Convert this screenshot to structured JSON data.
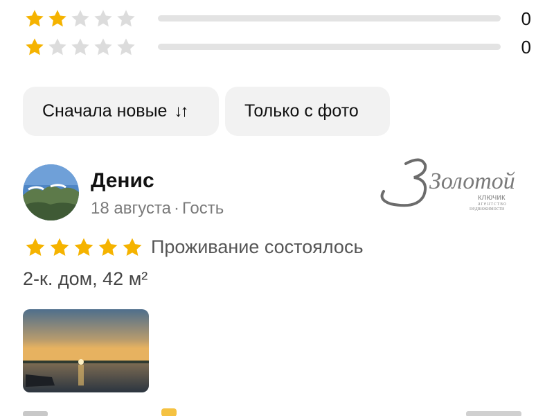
{
  "ratings": [
    {
      "stars": 2,
      "fraction": 0,
      "count": "0"
    },
    {
      "stars": 1,
      "fraction": 0,
      "count": "0"
    }
  ],
  "filters": {
    "sort_label": "Сначала новые",
    "sort_icon": "sort-arrows-icon",
    "photo_label": "Только с фото"
  },
  "review": {
    "author": "Денис",
    "date": "18 августа",
    "separator": "·",
    "role": "Гость",
    "stars": 5,
    "stay_status": "Проживание состоялось",
    "property": "2-к. дом, 42 м²"
  },
  "watermark": {
    "brand": "Золотой",
    "line1": "ключик",
    "line2": "агентство",
    "line3": "недвижимости"
  },
  "colors": {
    "star": "#f5b300",
    "star_empty": "#dcdcdc",
    "chip_bg": "#f2f2f2"
  }
}
